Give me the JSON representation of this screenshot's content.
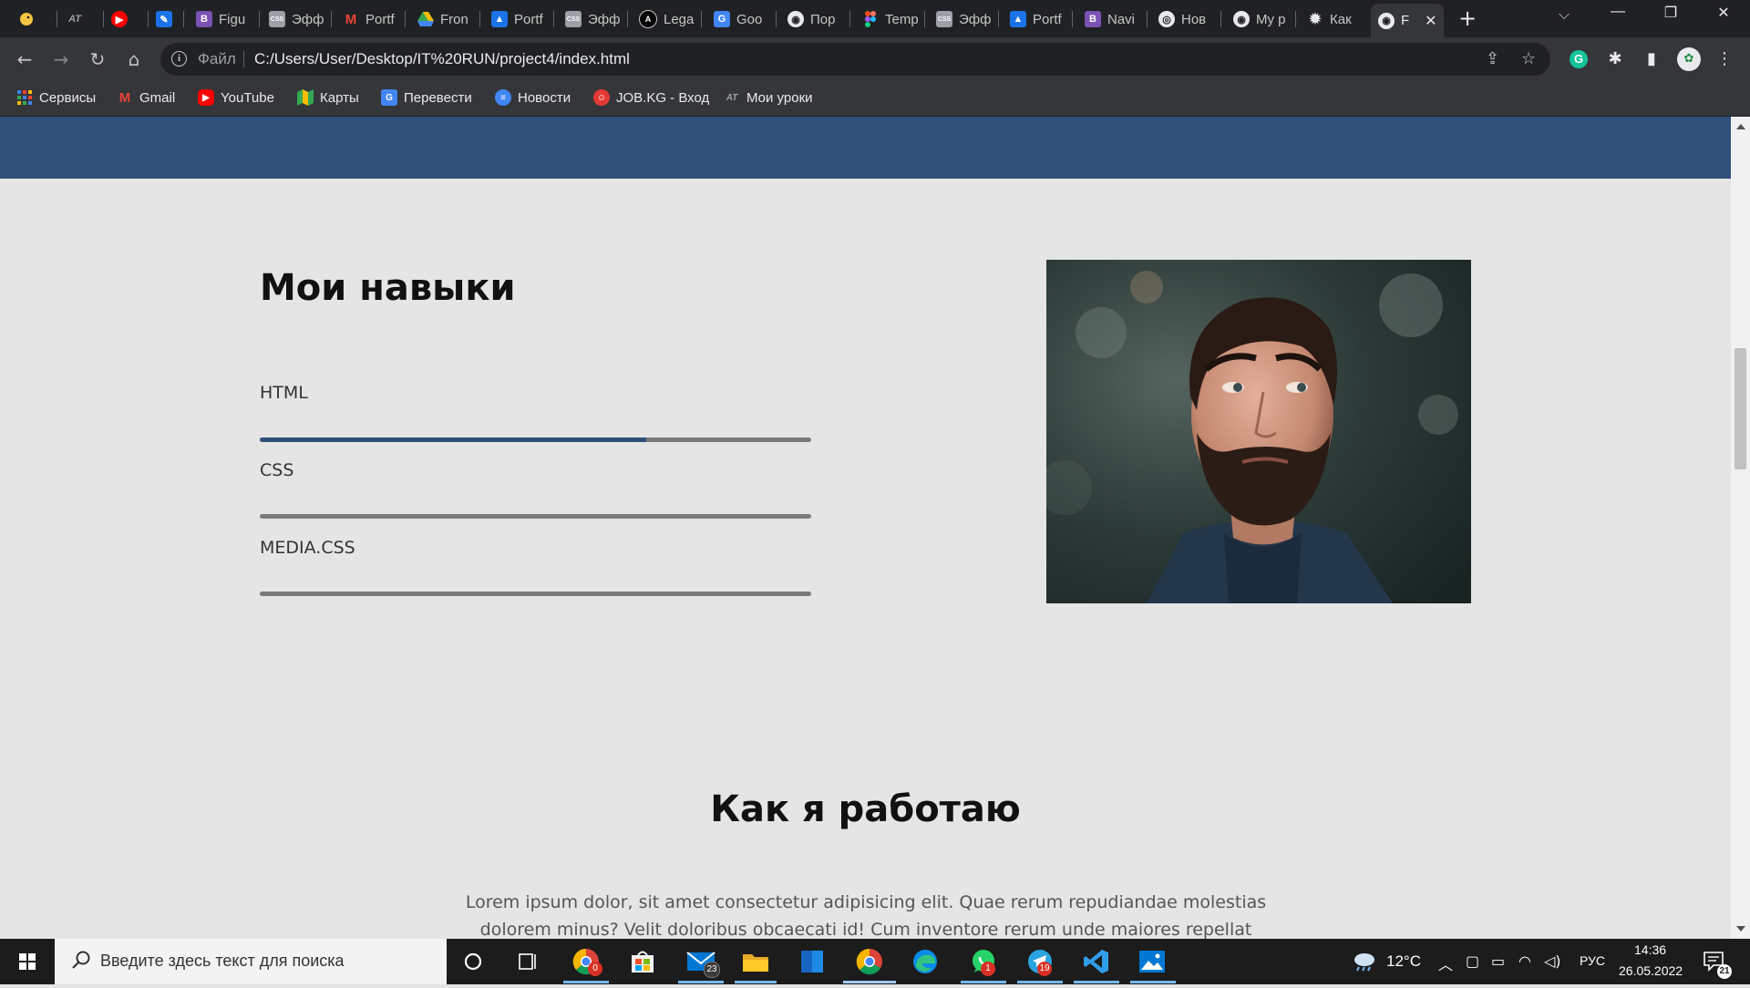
{
  "browser": {
    "tabs": [
      {
        "label": "",
        "icon": "duck-icon",
        "color": "#f6c343"
      },
      {
        "label": "",
        "icon": "at-icon",
        "color": "#5f6368"
      },
      {
        "label": "",
        "icon": "youtube-icon",
        "color": "#ff0000"
      },
      {
        "label": "",
        "icon": "pen-icon",
        "color": "#1a73e8"
      },
      {
        "label": "Figu",
        "icon": "bootstrap-icon",
        "color": "#7952b3"
      },
      {
        "label": "Эфф",
        "icon": "css-icon",
        "color": "#9aa0a6"
      },
      {
        "label": "Portf",
        "icon": "gmail-icon",
        "color": "#ea4335"
      },
      {
        "label": "Fron",
        "icon": "drive-icon",
        "color": "#34a853"
      },
      {
        "label": "Portf",
        "icon": "classroom-icon",
        "color": "#1a73e8"
      },
      {
        "label": "Эфф",
        "icon": "css-icon",
        "color": "#9aa0a6"
      },
      {
        "label": "Lega",
        "icon": "angular-icon",
        "color": "#000000"
      },
      {
        "label": "Goo",
        "icon": "translate-icon",
        "color": "#4285f4"
      },
      {
        "label": "Пор",
        "icon": "globe-icon",
        "color": "#e8eaed"
      },
      {
        "label": "Temp",
        "icon": "figma-icon",
        "color": "#f24e1e"
      },
      {
        "label": "Эфф",
        "icon": "css-icon",
        "color": "#9aa0a6"
      },
      {
        "label": "Portf",
        "icon": "classroom-icon",
        "color": "#1a73e8"
      },
      {
        "label": "Navi",
        "icon": "bootstrap-icon",
        "color": "#7952b3"
      },
      {
        "label": "Нов",
        "icon": "chrome-icon",
        "color": "#e8eaed"
      },
      {
        "label": "My p",
        "icon": "globe-icon",
        "color": "#e8eaed"
      },
      {
        "label": "Как",
        "icon": "gear-icon",
        "color": "#e8eaed"
      },
      {
        "label": "F",
        "icon": "globe-icon",
        "color": "#e8eaed"
      }
    ],
    "active_tab_index": 20,
    "new_tab_label": "+",
    "address": {
      "scheme_label": "Файл",
      "url": "C:/Users/User/Desktop/IT%20RUN/project4/index.html"
    },
    "bookmarks": [
      {
        "label": "Сервисы",
        "icon": "apps-grid-icon",
        "color": "#4285f4"
      },
      {
        "label": "Gmail",
        "icon": "gmail-icon",
        "color": "#ea4335"
      },
      {
        "label": "YouTube",
        "icon": "youtube-icon",
        "color": "#ff0000"
      },
      {
        "label": "Карты",
        "icon": "maps-icon",
        "color": "#34a853"
      },
      {
        "label": "Перевести",
        "icon": "translate-icon",
        "color": "#4285f4"
      },
      {
        "label": "Новости",
        "icon": "news-icon",
        "color": "#4285f4"
      },
      {
        "label": "JOB.KG - Вход",
        "icon": "jobkg-icon",
        "color": "#e53935"
      },
      {
        "label": "Мои уроки",
        "icon": "at-icon",
        "color": "#5f6368"
      }
    ]
  },
  "page": {
    "colors": {
      "header": "#2f5079",
      "accent": "#2f5079",
      "track": "#7a7a7a",
      "background": "#e5e5e5"
    },
    "skills_title": "Мои навыки",
    "skills": [
      {
        "name": "HTML",
        "level": 0.7
      },
      {
        "name": "CSS",
        "level": 0
      },
      {
        "name": "MEDIA.CSS",
        "level": 0
      }
    ],
    "how_title": "Как я работаю",
    "how_text": "Lorem ipsum dolor, sit amet consectetur adipisicing elit. Quae rerum repudiandae molestias dolorem minus? Velit doloribus obcaecati id! Cum inventore rerum unde maiores repellat perspiciatis distinctio"
  },
  "taskbar": {
    "search_placeholder": "Введите здесь текст для поиска",
    "apps": [
      {
        "name": "cortana-icon",
        "badge": ""
      },
      {
        "name": "task-view-icon",
        "badge": ""
      },
      {
        "name": "chrome-icon",
        "badge": "0"
      },
      {
        "name": "store-icon",
        "badge": ""
      },
      {
        "name": "mail-icon",
        "badge": "23"
      },
      {
        "name": "explorer-icon",
        "badge": ""
      },
      {
        "name": "word-icon",
        "badge": ""
      },
      {
        "name": "chrome-icon",
        "badge": ""
      },
      {
        "name": "edge-icon",
        "badge": ""
      },
      {
        "name": "whatsapp-icon",
        "badge": "1"
      },
      {
        "name": "telegram-icon",
        "badge": "19"
      },
      {
        "name": "vscode-icon",
        "badge": ""
      },
      {
        "name": "photos-icon",
        "badge": ""
      }
    ],
    "weather": "12°C",
    "language": "РУС",
    "time": "14:36",
    "date": "26.05.2022",
    "notifications": "21"
  }
}
